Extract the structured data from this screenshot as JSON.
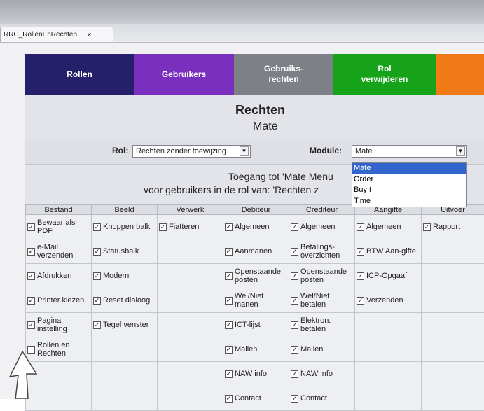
{
  "doc_tab": {
    "title": "RRC_RollenEnRechten",
    "close": "×"
  },
  "nav": [
    {
      "label": "Rollen",
      "color": "#26206a"
    },
    {
      "label": "Gebruikers",
      "color": "#7a2fbf"
    },
    {
      "label": "Gebruiks-\nrechten",
      "color": "#7d8087"
    },
    {
      "label": "Rol\nverwijderen",
      "color": "#17a319"
    },
    {
      "label": "",
      "color": "#f07a16"
    }
  ],
  "heading": {
    "title": "Rechten",
    "subtitle": "Mate"
  },
  "filters": {
    "rol_label": "Rol:",
    "rol_value": "Rechten zonder toewijzing",
    "module_label": "Module:",
    "module_value": "Mate",
    "module_options": [
      "Mate",
      "Order",
      "BuyIt",
      "Time"
    ]
  },
  "access": {
    "line1": "Toegang tot 'Mate Menu",
    "line2": "voor gebruikers in de rol van: 'Rechten z"
  },
  "columns": [
    "Bestand",
    "Beeld",
    "Verwerk",
    "Debiteur",
    "Crediteur",
    "Aangifte",
    "Uitvoer"
  ],
  "rows": [
    [
      "Bewaar als PDF",
      "Knoppen balk",
      "Fiatteren",
      "Algemeen",
      "Algemeen",
      "Algemeen",
      "Rapport"
    ],
    [
      "e-Mail verzenden",
      "Statusbalk",
      "",
      "Aanmanen",
      "Betalings-overzichten",
      "BTW Aan-gifte",
      ""
    ],
    [
      "Afdrukken",
      "Modern",
      "",
      "Openstaande posten",
      "Openstaande posten",
      "ICP-Opgaaf",
      ""
    ],
    [
      "Printer kiezen",
      "Reset dialoog",
      "",
      "Wel/Niet manen",
      "Wel/Niet betalen",
      "Verzenden",
      ""
    ],
    [
      "Pagina instelling",
      "Tegel venster",
      "",
      "ICT-lijst",
      "Elektron. betalen",
      "",
      ""
    ],
    [
      "Rollen en Rechten",
      "",
      "",
      "Mailen",
      "Mailen",
      "",
      ""
    ],
    [
      "",
      "",
      "",
      "NAW info",
      "NAW info",
      "",
      ""
    ],
    [
      "",
      "",
      "",
      "Contact",
      "Contact",
      "",
      ""
    ]
  ],
  "checked": [
    [
      true,
      true,
      true,
      true,
      true,
      true,
      true
    ],
    [
      true,
      true,
      false,
      true,
      true,
      true,
      false
    ],
    [
      true,
      true,
      false,
      true,
      true,
      true,
      false
    ],
    [
      true,
      true,
      false,
      true,
      true,
      true,
      false
    ],
    [
      true,
      true,
      false,
      true,
      true,
      false,
      false
    ],
    [
      false,
      false,
      false,
      true,
      true,
      false,
      false
    ],
    [
      false,
      false,
      false,
      true,
      true,
      false,
      false
    ],
    [
      false,
      false,
      false,
      true,
      true,
      false,
      false
    ]
  ]
}
